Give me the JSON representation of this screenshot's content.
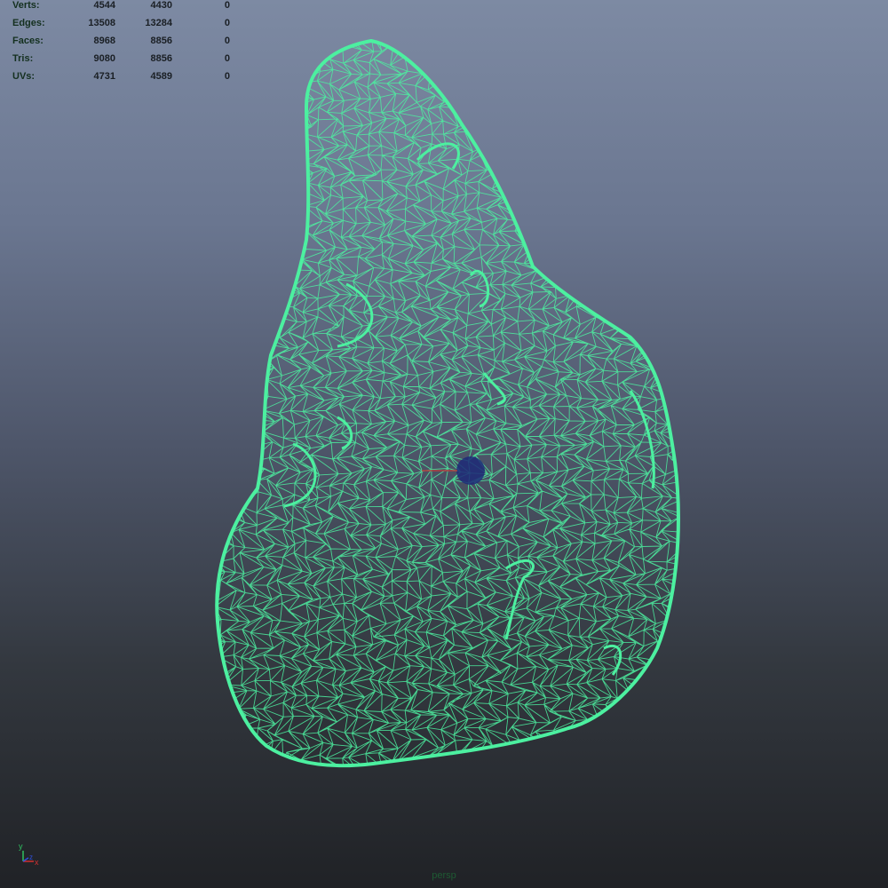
{
  "hud": {
    "rows": [
      {
        "label": "Verts:",
        "v1": "4544",
        "v2": "4430",
        "v3": "0"
      },
      {
        "label": "Edges:",
        "v1": "13508",
        "v2": "13284",
        "v3": "0"
      },
      {
        "label": "Faces:",
        "v1": "8968",
        "v2": "8856",
        "v3": "0"
      },
      {
        "label": "Tris:",
        "v1": "9080",
        "v2": "8856",
        "v3": "0"
      },
      {
        "label": "UVs:",
        "v1": "4731",
        "v2": "4589",
        "v3": "0"
      }
    ]
  },
  "axis": {
    "y": "y",
    "x": "x",
    "z": "z"
  },
  "camera": {
    "name": "persp"
  },
  "colors": {
    "wireframe": "#4cf0a0",
    "hud_text": "#1a1f24",
    "axis_x": "#d03030",
    "axis_y": "#30c060",
    "axis_z": "#3050e0"
  }
}
